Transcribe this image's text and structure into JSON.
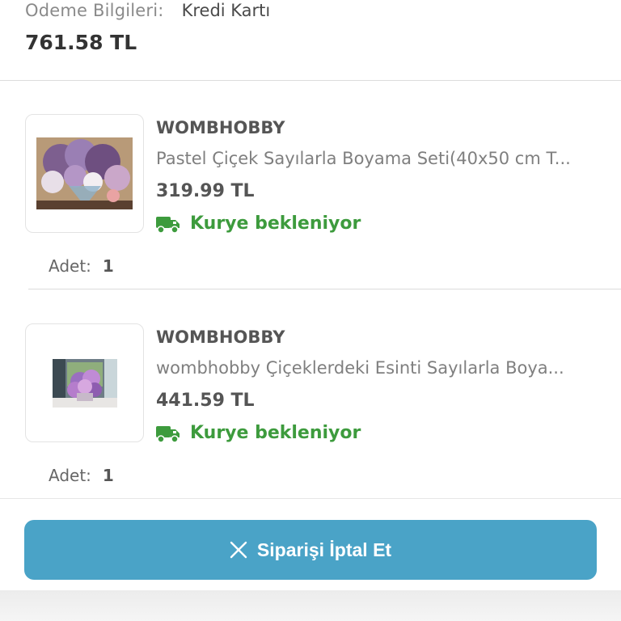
{
  "payment": {
    "label": "Odeme Bilgileri:",
    "value": "Kredi Kartı"
  },
  "total": "761.58 TL",
  "items": [
    {
      "brand": "WOMBHOBBY",
      "name": "Pastel Çiçek Sayılarla Boyama Seti(40x50 cm T...",
      "price": "319.99 TL",
      "status": "Kurye bekleniyor",
      "qty_label": "Adet:",
      "qty": "1"
    },
    {
      "brand": "WOMBHOBBY",
      "name": "wombhobby Çiçeklerdeki Esinti Sayılarla Boya...",
      "price": "441.59 TL",
      "status": "Kurye bekleniyor",
      "qty_label": "Adet:",
      "qty": "1"
    }
  ],
  "cancel_button": {
    "label": "Siparişi İptal Et",
    "icon": "close-icon"
  },
  "colors": {
    "accent": "#4aa3c7",
    "status_green": "#3d9b3d",
    "divider": "#dcdcdc"
  },
  "icons": {
    "status": "truck-icon"
  }
}
